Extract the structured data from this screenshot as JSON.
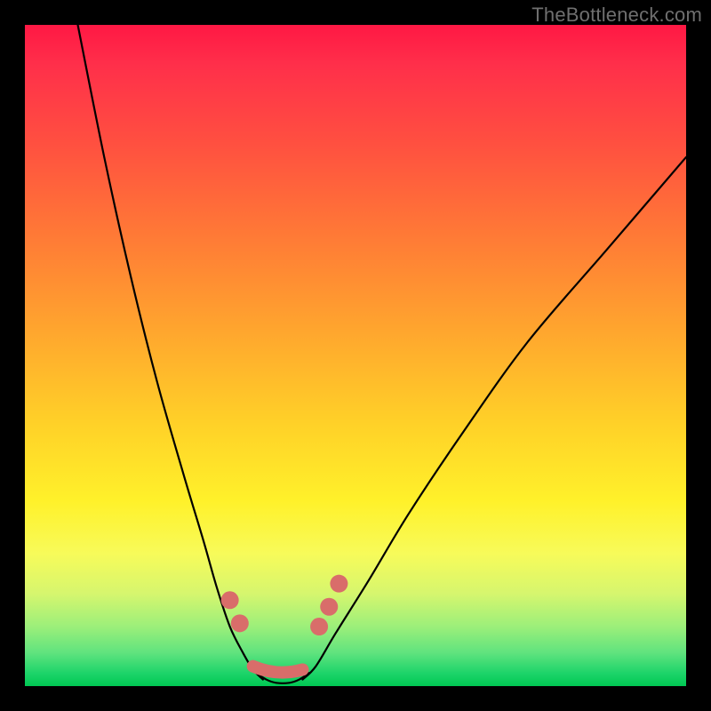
{
  "watermark": "TheBottleneck.com",
  "colors": {
    "frame": "#000000",
    "gradient_top": "#ff1844",
    "gradient_mid": "#ffd028",
    "gradient_bottom": "#00c853",
    "curve": "#000000",
    "marker": "#d96d6a"
  },
  "chart_data": {
    "type": "line",
    "title": "",
    "xlabel": "",
    "ylabel": "",
    "xlim": [
      0,
      100
    ],
    "ylim": [
      0,
      100
    ],
    "series": [
      {
        "name": "left-curve",
        "x": [
          8,
          12,
          16,
          20,
          24,
          27,
          29,
          31,
          33,
          34.5,
          36
        ],
        "y": [
          100,
          80,
          62,
          46,
          32,
          22,
          15,
          9,
          5,
          2.5,
          1
        ]
      },
      {
        "name": "right-curve",
        "x": [
          42,
          44,
          47,
          52,
          58,
          66,
          76,
          88,
          100
        ],
        "y": [
          1,
          3,
          8,
          16,
          26,
          38,
          52,
          66,
          80
        ]
      },
      {
        "name": "valley-bottom",
        "x": [
          35,
          36.5,
          38,
          40,
          41.5,
          43
        ],
        "y": [
          2,
          1,
          0.5,
          0.5,
          1,
          2
        ]
      }
    ],
    "overlays": [
      {
        "name": "marker-left-upper",
        "shape": "dot",
        "x": 31.0,
        "y": 13.0
      },
      {
        "name": "marker-left-lower",
        "shape": "dot",
        "x": 32.5,
        "y": 9.5
      },
      {
        "name": "marker-bottom-run",
        "shape": "segment",
        "x0": 34.5,
        "y0": 3.0,
        "x1": 42.0,
        "y1": 2.5
      },
      {
        "name": "marker-right-lower",
        "shape": "dot",
        "x": 44.5,
        "y": 9.0
      },
      {
        "name": "marker-right-mid",
        "shape": "dot",
        "x": 46.0,
        "y": 12.0
      },
      {
        "name": "marker-right-upper",
        "shape": "dot",
        "x": 47.5,
        "y": 15.5
      }
    ]
  }
}
